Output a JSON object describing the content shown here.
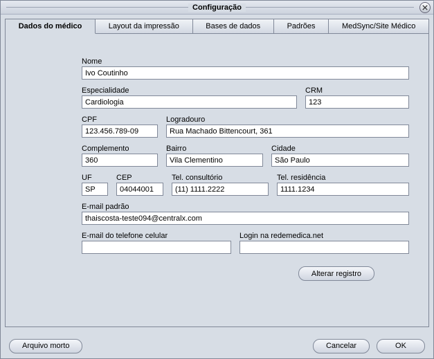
{
  "window": {
    "title": "Configuração"
  },
  "tabs": {
    "t0": "Dados do médico",
    "t1": "Layout da impressão",
    "t2": "Bases de dados",
    "t3": "Padrões",
    "t4": "MedSync/Site Médico"
  },
  "labels": {
    "nome": "Nome",
    "especialidade": "Especialidade",
    "crm": "CRM",
    "cpf": "CPF",
    "logradouro": "Logradouro",
    "complemento": "Complemento",
    "bairro": "Bairro",
    "cidade": "Cidade",
    "uf": "UF",
    "cep": "CEP",
    "tel_consultorio": "Tel. consultório",
    "tel_residencia": "Tel. residência",
    "email_padrao": "E-mail padrão",
    "email_celular": "E-mail do telefone celular",
    "login_redemedica": "Login na redemedica.net"
  },
  "values": {
    "nome": "Ivo Coutinho",
    "especialidade": "Cardiologia",
    "crm": "123",
    "cpf": "123.456.789-09",
    "logradouro": "Rua Machado Bittencourt, 361",
    "complemento": "360",
    "bairro": "Vila Clementino",
    "cidade": "São Paulo",
    "uf": "SP",
    "cep": "04044001",
    "tel_consultorio": "(11) 1111.2222",
    "tel_residencia": "1111.1234",
    "email_padrao": "thaiscosta-teste094@centralx.com",
    "email_celular": "",
    "login_redemedica": ""
  },
  "buttons": {
    "alterar_registro": "Alterar registro",
    "arquivo_morto": "Arquivo morto",
    "cancelar": "Cancelar",
    "ok": "OK"
  }
}
